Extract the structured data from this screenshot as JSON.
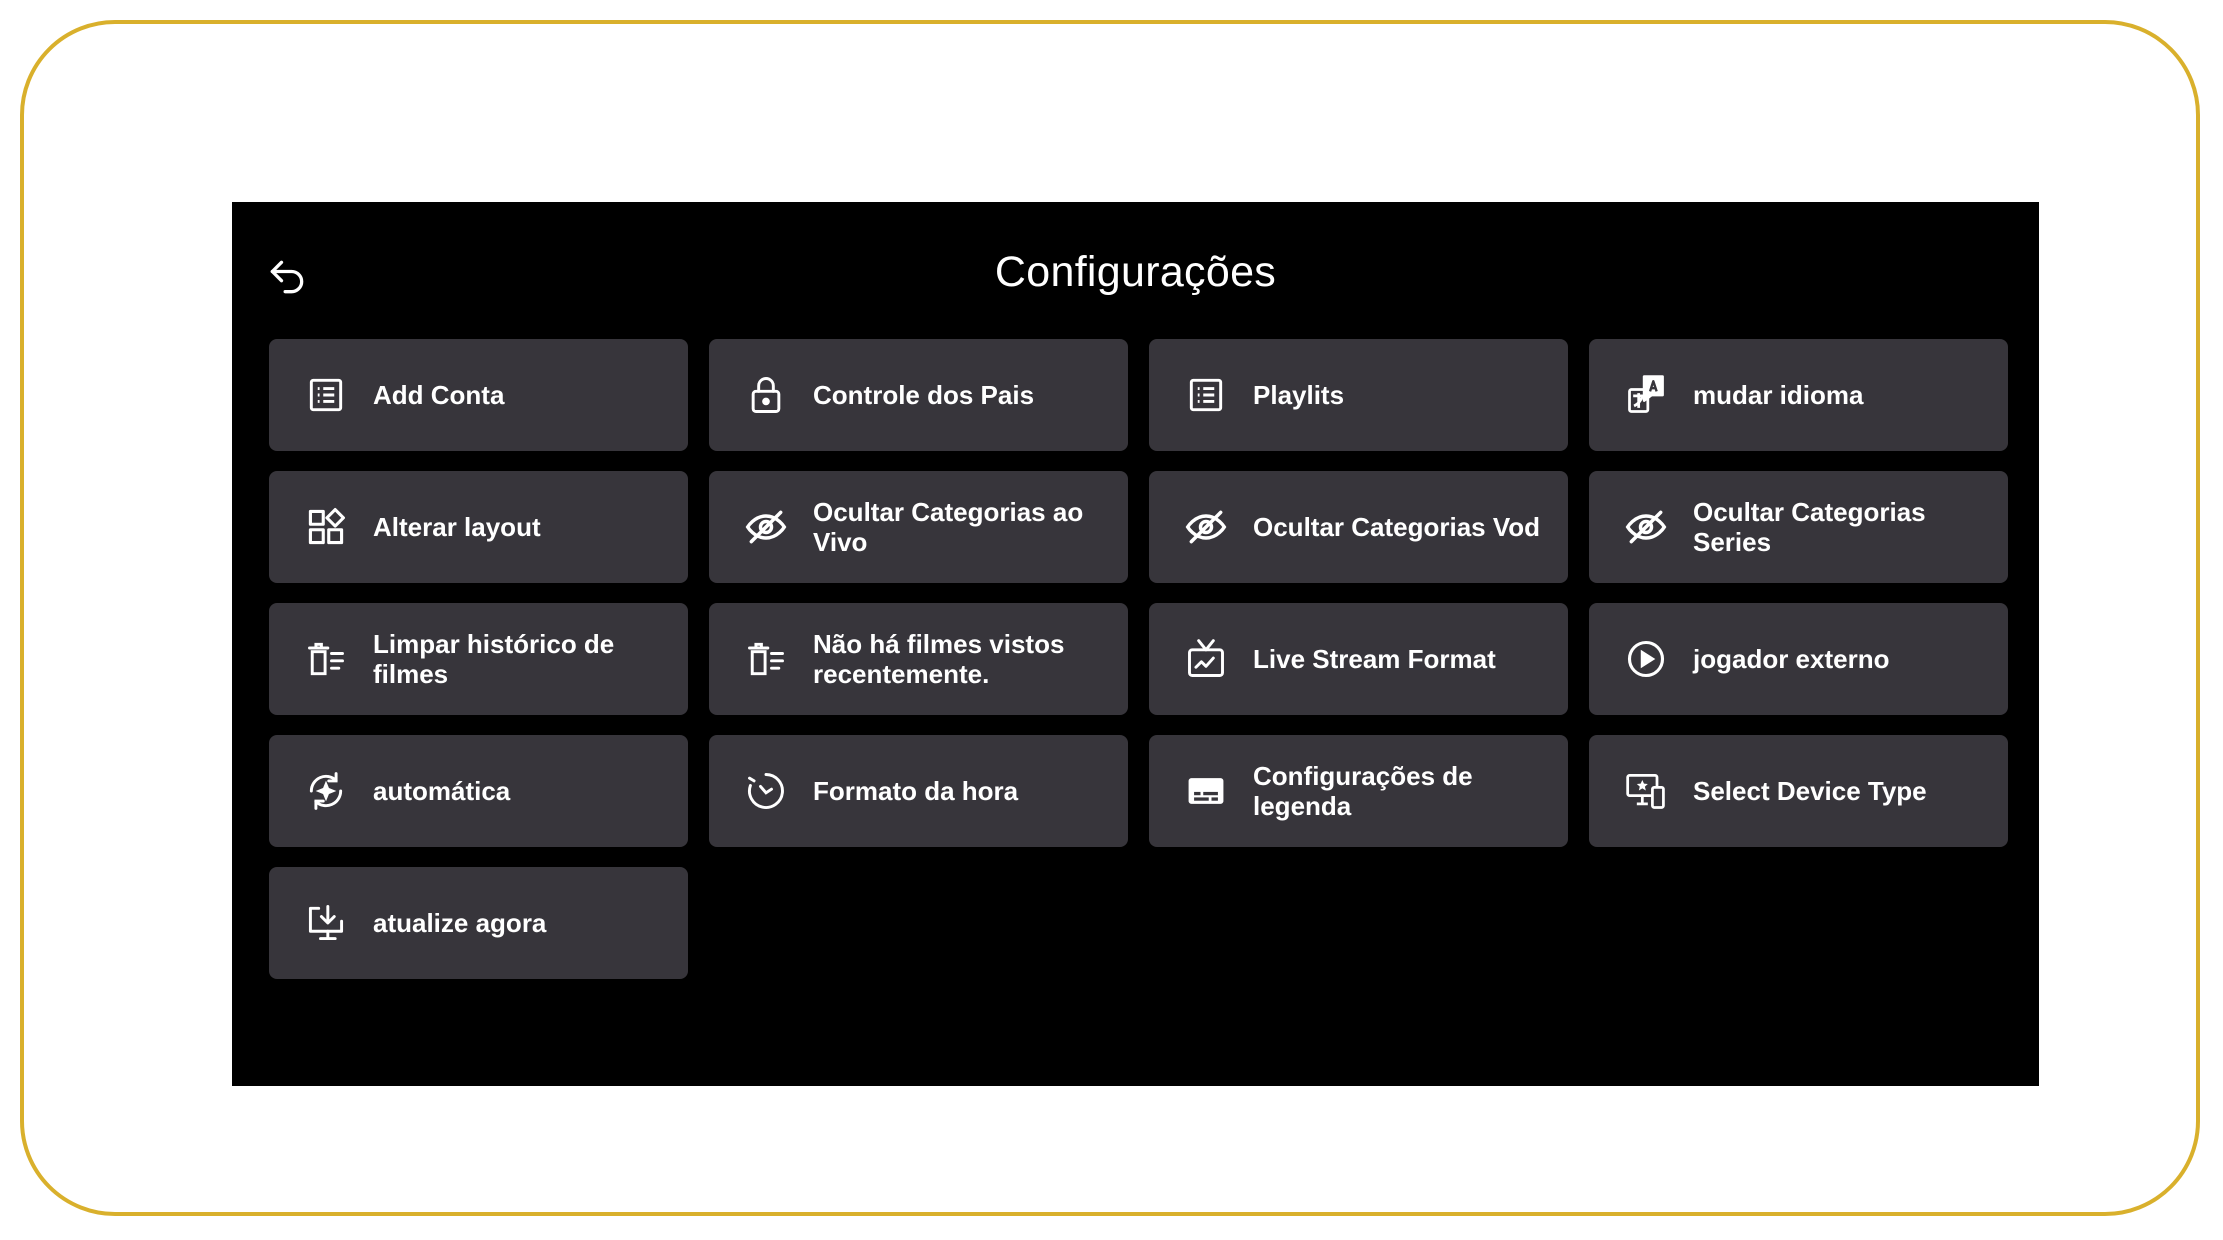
{
  "header": {
    "title": "Configurações",
    "back_icon": "back-arrow-icon"
  },
  "colors": {
    "frame_border": "#d9b02c",
    "screen_bg": "#000000",
    "tile_bg": "#37353b",
    "text": "#ffffff"
  },
  "tiles": [
    {
      "label": "Add Conta",
      "icon": "list-icon"
    },
    {
      "label": "Controle dos Pais",
      "icon": "lock-icon"
    },
    {
      "label": "Playlits",
      "icon": "list-icon"
    },
    {
      "label": "mudar idioma",
      "icon": "translate-icon"
    },
    {
      "label": "Alterar layout",
      "icon": "layout-icon"
    },
    {
      "label": "Ocultar Categorias ao Vivo",
      "icon": "eye-off-icon"
    },
    {
      "label": "Ocultar Categorias Vod",
      "icon": "eye-off-icon"
    },
    {
      "label": "Ocultar Categorias Series",
      "icon": "eye-off-icon"
    },
    {
      "label": "Limpar histórico de filmes",
      "icon": "clear-history-icon"
    },
    {
      "label": "Não há filmes vistos recentemente.",
      "icon": "clear-history-icon"
    },
    {
      "label": "Live Stream Format",
      "icon": "tv-icon"
    },
    {
      "label": "jogador externo",
      "icon": "play-circle-icon"
    },
    {
      "label": "automática",
      "icon": "auto-refresh-icon"
    },
    {
      "label": "Formato da hora",
      "icon": "clock-icon"
    },
    {
      "label": "Configurações de legenda",
      "icon": "subtitles-icon"
    },
    {
      "label": "Select Device Type",
      "icon": "device-type-icon"
    },
    {
      "label": "atualize agora",
      "icon": "download-update-icon"
    }
  ]
}
